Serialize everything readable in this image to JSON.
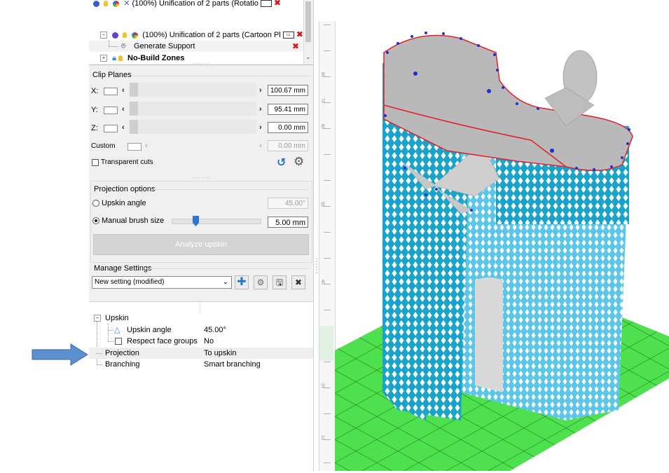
{
  "tree": {
    "rows": [
      {
        "label": "(100%) Unification of 2 parts (Rotatio"
      },
      {
        "label": "(100%) Unification of 2 parts (Cartoon Pl"
      },
      {
        "label": "Generate Support"
      },
      {
        "label": "No-Build Zones"
      }
    ]
  },
  "clip_planes": {
    "title": "Clip Planes",
    "x_label": "X:",
    "x_value": "100.67 mm",
    "y_label": "Y:",
    "y_value": "95.41 mm",
    "z_label": "Z:",
    "z_value": "0.00 mm",
    "custom_label": "Custom",
    "custom_value": "0.00 mm",
    "transparent_cuts_label": "Transparent cuts"
  },
  "projection_options": {
    "title": "Projection options",
    "upskin_angle_label": "Upskin angle",
    "upskin_angle_value": "45.00°",
    "manual_brush_label": "Manual brush size",
    "manual_brush_value": "5.00 mm",
    "brush_slider_fraction": 0.27,
    "analyze_button": "Analyze upskin"
  },
  "manage_settings": {
    "title": "Manage Settings",
    "selected": "New setting (modified)"
  },
  "properties": {
    "group": "Upskin",
    "upskin_angle_label": "Upskin angle",
    "upskin_angle_value": "45.00°",
    "respect_face_groups_label": "Respect face groups",
    "respect_face_groups_value": "No",
    "projection_label": "Projection",
    "projection_value": "To upskin",
    "branching_label": "Branching",
    "branching_value": "Smart branching"
  },
  "ruler": {
    "labels": [
      "80",
      "70",
      "60",
      "50",
      "40",
      "30",
      "20",
      "10"
    ]
  },
  "colors": {
    "support_blue": "#1aa3c9",
    "support_light": "#5cc6e8",
    "build_plate": "#4ee04e",
    "part_gray": "#bdbdbd",
    "edge_red": "#e0202a",
    "point_blue": "#2030d0",
    "arrow_blue": "#5b8fd0",
    "reset_blue": "#2a6fd0",
    "add_blue": "#2a78d0"
  }
}
